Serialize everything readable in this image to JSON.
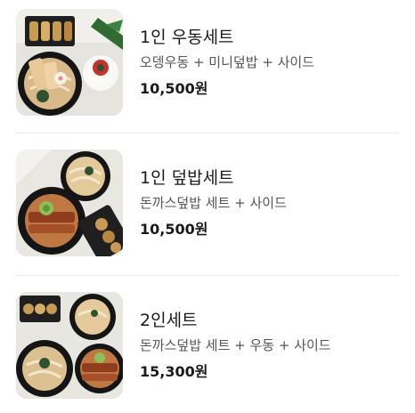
{
  "menu": {
    "items": [
      {
        "title": "1인 우동세트",
        "description": "오뎅우동 + 미니덮밥 + 사이드",
        "price": "10,500원",
        "image": "udon-set-photo"
      },
      {
        "title": "1인 덮밥세트",
        "description": "돈까스덮밥 세트 + 사이드",
        "price": "10,500원",
        "image": "donburi-set-photo"
      },
      {
        "title": "2인세트",
        "description": "돈까스덮밥 세트 + 우동 + 사이드",
        "price": "15,300원",
        "image": "two-person-set-photo"
      }
    ]
  }
}
